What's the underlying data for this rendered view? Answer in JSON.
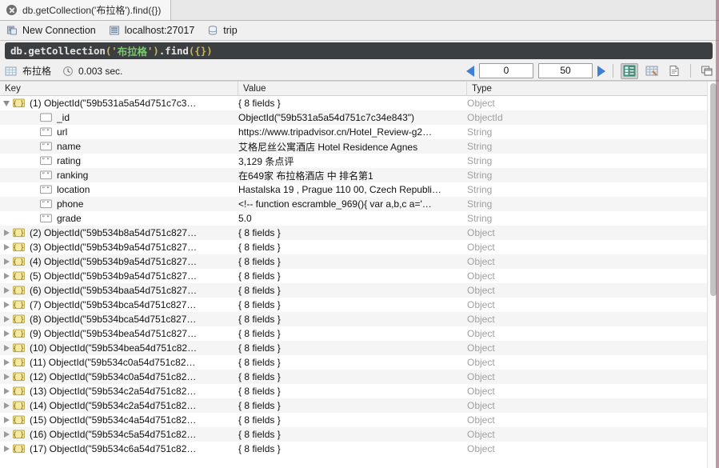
{
  "window": {
    "tab_label": "db.getCollection('布拉格').find({})",
    "close_icon": "close-circle-icon"
  },
  "breadcrumb": {
    "items": [
      {
        "label": "New Connection",
        "icon": "connection-icon"
      },
      {
        "label": "localhost:27017",
        "icon": "server-icon"
      },
      {
        "label": "trip",
        "icon": "database-icon"
      }
    ]
  },
  "query_bar": {
    "full_text": "db.getCollection('布拉格').find({})",
    "tokens": [
      {
        "text": "db.getCollection",
        "kind": "plain"
      },
      {
        "text": "('",
        "kind": "punc"
      },
      {
        "text": "布拉格",
        "kind": "str"
      },
      {
        "text": "')",
        "kind": "punc"
      },
      {
        "text": ".find",
        "kind": "plain"
      },
      {
        "text": "({})",
        "kind": "punc"
      }
    ],
    "colors": {
      "plain": "#e6e6e6",
      "punc": "#c9b458",
      "string": "#7bc96f",
      "background": "#3c3f41"
    }
  },
  "result_toolbar": {
    "collection_icon": "table-grid-icon",
    "collection_name": "布拉格",
    "time_icon": "clock-icon",
    "elapsed": "0.003 sec.",
    "prev_icon": "prev-arrow-icon",
    "next_icon": "next-arrow-icon",
    "skip_value": "0",
    "limit_value": "50",
    "view_buttons": [
      {
        "name": "tree-view-button",
        "icon": "tree-view-icon",
        "selected": true
      },
      {
        "name": "table-view-button",
        "icon": "table-view-icon",
        "selected": false
      },
      {
        "name": "json-view-button",
        "icon": "document-icon",
        "selected": false
      },
      {
        "name": "detach-view-button",
        "icon": "window-icon",
        "selected": false
      }
    ]
  },
  "table": {
    "columns": [
      "Key",
      "Value",
      "Type"
    ],
    "rows": [
      {
        "level": 0,
        "expanded": true,
        "icon": "object-braces-icon",
        "key": "(1) ObjectId(\"59b531a5a54d751c7c3…",
        "value": "{ 8 fields }",
        "type": "Object"
      },
      {
        "level": 1,
        "expanded": null,
        "icon": "objectid-icon",
        "key": "_id",
        "value": "ObjectId(\"59b531a5a54d751c7c34e843\")",
        "type": "ObjectId"
      },
      {
        "level": 1,
        "expanded": null,
        "icon": "string-quotes-icon",
        "key": "url",
        "value": "https://www.tripadvisor.cn/Hotel_Review-g2…",
        "type": "String"
      },
      {
        "level": 1,
        "expanded": null,
        "icon": "string-quotes-icon",
        "key": "name",
        "value": "艾格尼丝公寓酒店 Hotel Residence Agnes",
        "type": "String"
      },
      {
        "level": 1,
        "expanded": null,
        "icon": "string-quotes-icon",
        "key": "rating",
        "value": "3,129 条点评",
        "type": "String"
      },
      {
        "level": 1,
        "expanded": null,
        "icon": "string-quotes-icon",
        "key": "ranking",
        "value": "在649家 布拉格酒店 中 排名第1",
        "type": "String"
      },
      {
        "level": 1,
        "expanded": null,
        "icon": "string-quotes-icon",
        "key": "location",
        "value": "Hastalska 19 , Prague 110 00, Czech Republi…",
        "type": "String"
      },
      {
        "level": 1,
        "expanded": null,
        "icon": "string-quotes-icon",
        "key": "phone",
        "value": "<!-- function escramble_969(){ var a,b,c a='…",
        "type": "String"
      },
      {
        "level": 1,
        "expanded": null,
        "icon": "string-quotes-icon",
        "key": "grade",
        "value": "5.0",
        "type": "String"
      },
      {
        "level": 0,
        "expanded": false,
        "icon": "object-braces-icon",
        "key": "(2) ObjectId(\"59b534b8a54d751c827…",
        "value": "{ 8 fields }",
        "type": "Object"
      },
      {
        "level": 0,
        "expanded": false,
        "icon": "object-braces-icon",
        "key": "(3) ObjectId(\"59b534b9a54d751c827…",
        "value": "{ 8 fields }",
        "type": "Object"
      },
      {
        "level": 0,
        "expanded": false,
        "icon": "object-braces-icon",
        "key": "(4) ObjectId(\"59b534b9a54d751c827…",
        "value": "{ 8 fields }",
        "type": "Object"
      },
      {
        "level": 0,
        "expanded": false,
        "icon": "object-braces-icon",
        "key": "(5) ObjectId(\"59b534b9a54d751c827…",
        "value": "{ 8 fields }",
        "type": "Object"
      },
      {
        "level": 0,
        "expanded": false,
        "icon": "object-braces-icon",
        "key": "(6) ObjectId(\"59b534baa54d751c827…",
        "value": "{ 8 fields }",
        "type": "Object"
      },
      {
        "level": 0,
        "expanded": false,
        "icon": "object-braces-icon",
        "key": "(7) ObjectId(\"59b534bca54d751c827…",
        "value": "{ 8 fields }",
        "type": "Object"
      },
      {
        "level": 0,
        "expanded": false,
        "icon": "object-braces-icon",
        "key": "(8) ObjectId(\"59b534bca54d751c827…",
        "value": "{ 8 fields }",
        "type": "Object"
      },
      {
        "level": 0,
        "expanded": false,
        "icon": "object-braces-icon",
        "key": "(9) ObjectId(\"59b534bea54d751c827…",
        "value": "{ 8 fields }",
        "type": "Object"
      },
      {
        "level": 0,
        "expanded": false,
        "icon": "object-braces-icon",
        "key": "(10) ObjectId(\"59b534bea54d751c82…",
        "value": "{ 8 fields }",
        "type": "Object"
      },
      {
        "level": 0,
        "expanded": false,
        "icon": "object-braces-icon",
        "key": "(11) ObjectId(\"59b534c0a54d751c82…",
        "value": "{ 8 fields }",
        "type": "Object"
      },
      {
        "level": 0,
        "expanded": false,
        "icon": "object-braces-icon",
        "key": "(12) ObjectId(\"59b534c0a54d751c82…",
        "value": "{ 8 fields }",
        "type": "Object"
      },
      {
        "level": 0,
        "expanded": false,
        "icon": "object-braces-icon",
        "key": "(13) ObjectId(\"59b534c2a54d751c82…",
        "value": "{ 8 fields }",
        "type": "Object"
      },
      {
        "level": 0,
        "expanded": false,
        "icon": "object-braces-icon",
        "key": "(14) ObjectId(\"59b534c2a54d751c82…",
        "value": "{ 8 fields }",
        "type": "Object"
      },
      {
        "level": 0,
        "expanded": false,
        "icon": "object-braces-icon",
        "key": "(15) ObjectId(\"59b534c4a54d751c82…",
        "value": "{ 8 fields }",
        "type": "Object"
      },
      {
        "level": 0,
        "expanded": false,
        "icon": "object-braces-icon",
        "key": "(16) ObjectId(\"59b534c5a54d751c82…",
        "value": "{ 8 fields }",
        "type": "Object"
      },
      {
        "level": 0,
        "expanded": false,
        "icon": "object-braces-icon",
        "key": "(17) ObjectId(\"59b534c6a54d751c82…",
        "value": "{ 8 fields }",
        "type": "Object"
      }
    ]
  },
  "scrollbar": {
    "name": "vertical-scrollbar",
    "thumb_fraction": 0.55
  }
}
